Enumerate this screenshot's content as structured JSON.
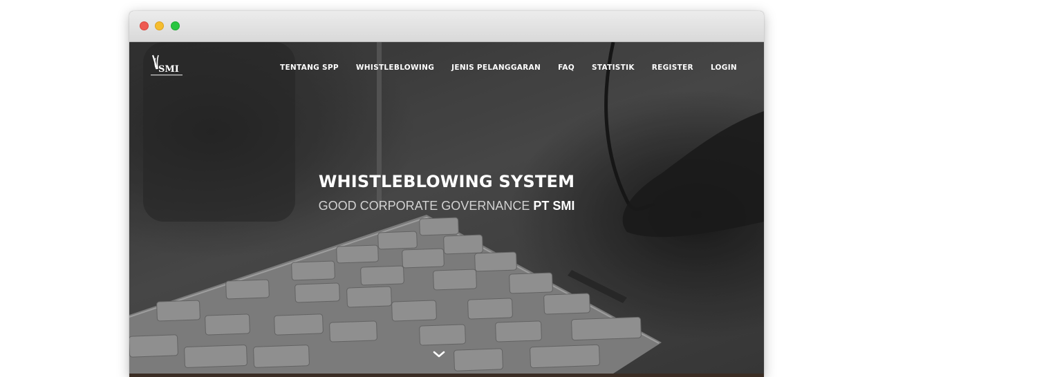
{
  "nav": {
    "items": [
      {
        "label": "TENTANG SPP"
      },
      {
        "label": "WHISTLEBLOWING"
      },
      {
        "label": "JENIS PELANGGARAN"
      },
      {
        "label": "FAQ"
      },
      {
        "label": "STATISTIK"
      },
      {
        "label": "REGISTER"
      },
      {
        "label": "LOGIN"
      }
    ]
  },
  "logo": {
    "text": "SMI"
  },
  "hero": {
    "title": "WHISTLEBLOWING SYSTEM",
    "subtitle_prefix": "GOOD CORPORATE GOVERNANCE",
    "subtitle_brand": "PT SMI"
  },
  "icons": {
    "scroll": "chevron-down-icon"
  },
  "colors": {
    "nav_text": "#ffffff",
    "subtitle": "#d2d2d2",
    "overlay": "#4a4a4a"
  }
}
